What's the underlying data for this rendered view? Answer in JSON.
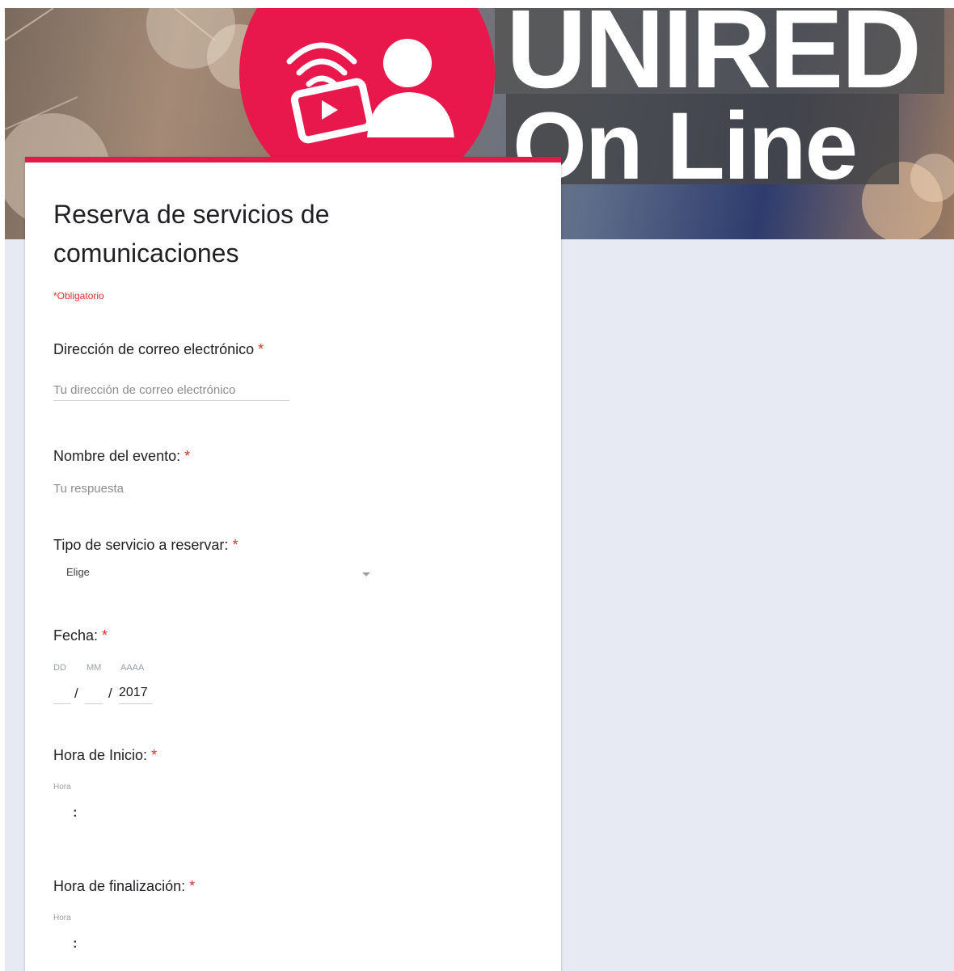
{
  "banner": {
    "line1": "UNIRED",
    "line2": "On Line",
    "logo_icon": "broadcast-user-icon",
    "colors": {
      "logo_circle": "#e8174c",
      "plate": "#555555"
    }
  },
  "form": {
    "title": "Reserva de servicios de comunicaciones",
    "required_note": "*Obligatorio",
    "accent_color": "#e8174c",
    "questions": {
      "email": {
        "label": "Dirección de correo electrónico",
        "required_mark": "*",
        "placeholder": "Tu dirección de correo electrónico"
      },
      "event_name": {
        "label": "Nombre del evento:",
        "required_mark": "*",
        "placeholder": "Tu respuesta"
      },
      "service_type": {
        "label": "Tipo de servicio a reservar:",
        "required_mark": "*",
        "selected": "Elige"
      },
      "date": {
        "label": "Fecha:",
        "required_mark": "*",
        "day_label": "DD",
        "month_label": "MM",
        "year_label": "AAAA",
        "separator": "/",
        "day_value": "",
        "month_value": "",
        "year_value": "2017"
      },
      "start_time": {
        "label": "Hora de Inicio:",
        "required_mark": "*",
        "sub_label": "Hora",
        "separator": ":"
      },
      "end_time": {
        "label": "Hora de finalización:",
        "required_mark": "*",
        "sub_label": "Hora",
        "separator": ":"
      }
    }
  }
}
